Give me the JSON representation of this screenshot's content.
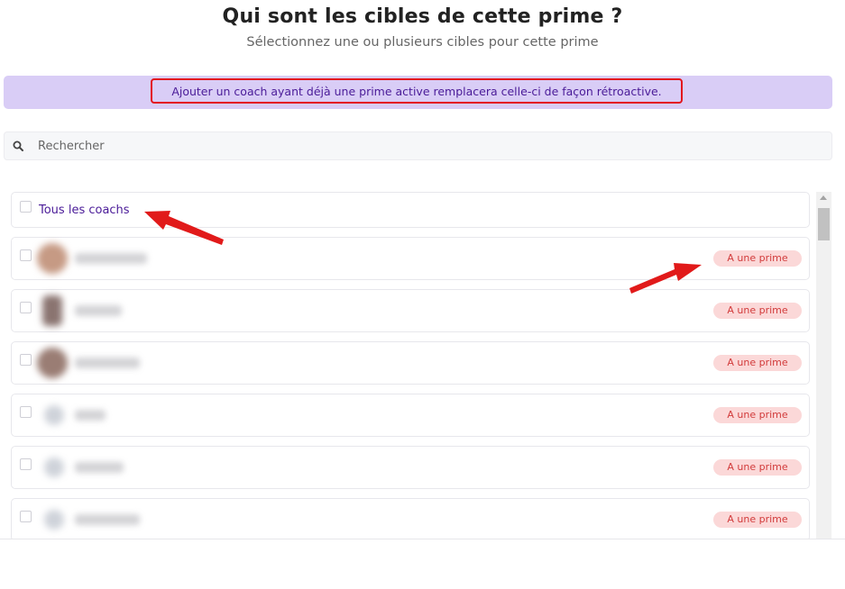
{
  "header": {
    "title": "Qui sont les cibles de cette prime ?",
    "subtitle": "Sélectionnez une ou plusieurs cibles pour cette prime"
  },
  "notice": {
    "text": "Ajouter un coach ayant déjà une prime active remplacera celle-ci de façon rétroactive."
  },
  "search": {
    "placeholder": "Rechercher"
  },
  "list": {
    "all_label": "Tous les coachs",
    "coaches": [
      {
        "badge": "A une prime"
      },
      {
        "badge": "A une prime"
      },
      {
        "badge": "A une prime"
      },
      {
        "badge": "A une prime"
      },
      {
        "badge": "A une prime"
      },
      {
        "badge": "A une prime"
      }
    ]
  },
  "colors": {
    "accent": "#4a1b98",
    "notice_bg": "#d9cdf6",
    "highlight": "#e3141b",
    "badge_bg": "#fbd8d8",
    "badge_text": "#d23b3b"
  },
  "icons": {
    "search": "search-icon",
    "arrow": "red-arrow-annotation"
  }
}
